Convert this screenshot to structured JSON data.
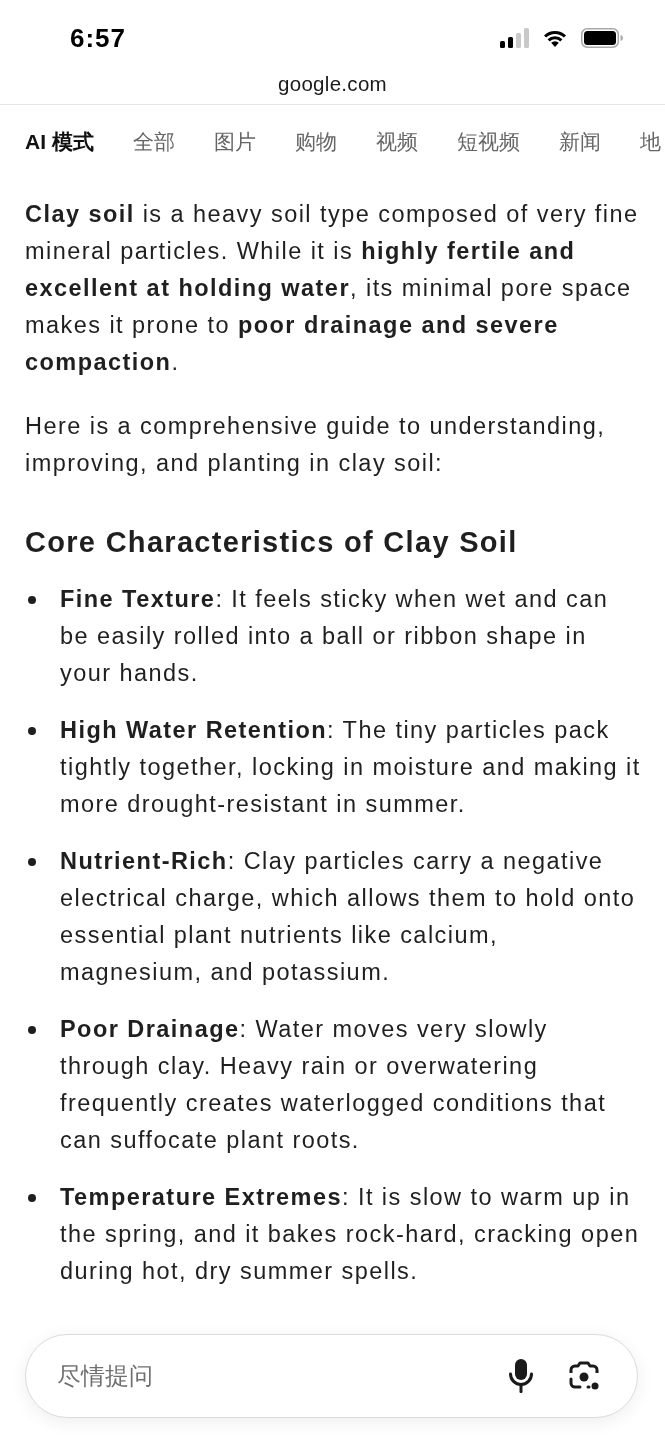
{
  "status_bar": {
    "time": "6:57"
  },
  "address_bar": {
    "url": "google.com"
  },
  "tabs": [
    {
      "label": "AI 模式",
      "selected": true
    },
    {
      "label": "全部",
      "selected": false
    },
    {
      "label": "图片",
      "selected": false
    },
    {
      "label": "购物",
      "selected": false
    },
    {
      "label": "视频",
      "selected": false
    },
    {
      "label": "短视频",
      "selected": false
    },
    {
      "label": "新闻",
      "selected": false
    },
    {
      "label": "地",
      "selected": false
    }
  ],
  "answer": {
    "paragraphs": [
      "**Clay soil** is a heavy soil type composed of very fine mineral particles. While it is **highly fertile and excellent at holding water**, its minimal pore space makes it prone to **poor drainage and severe compaction**.",
      "Here is a comprehensive guide to understanding, improving, and planting in clay soil:"
    ],
    "heading": "Core Characteristics of Clay Soil",
    "bullets": [
      "**Fine Texture**: It feels sticky when wet and can be easily rolled into a ball or ribbon shape in your hands.",
      "**High Water Retention**: The tiny particles pack tightly together, locking in moisture and making it more drought-resistant in summer.",
      "**Nutrient-Rich**: Clay particles carry a negative electrical charge, which allows them to hold onto essential plant nutrients like calcium, magnesium, and potassium.",
      "**Poor Drainage**: Water moves very slowly through clay. Heavy rain or overwatering frequently creates waterlogged conditions that can suffocate plant roots.",
      "**Temperature Extremes**: It is slow to warm up in the spring, and it bakes rock-hard, cracking open during hot, dry summer spells."
    ]
  },
  "search": {
    "placeholder": "尽情提问"
  }
}
